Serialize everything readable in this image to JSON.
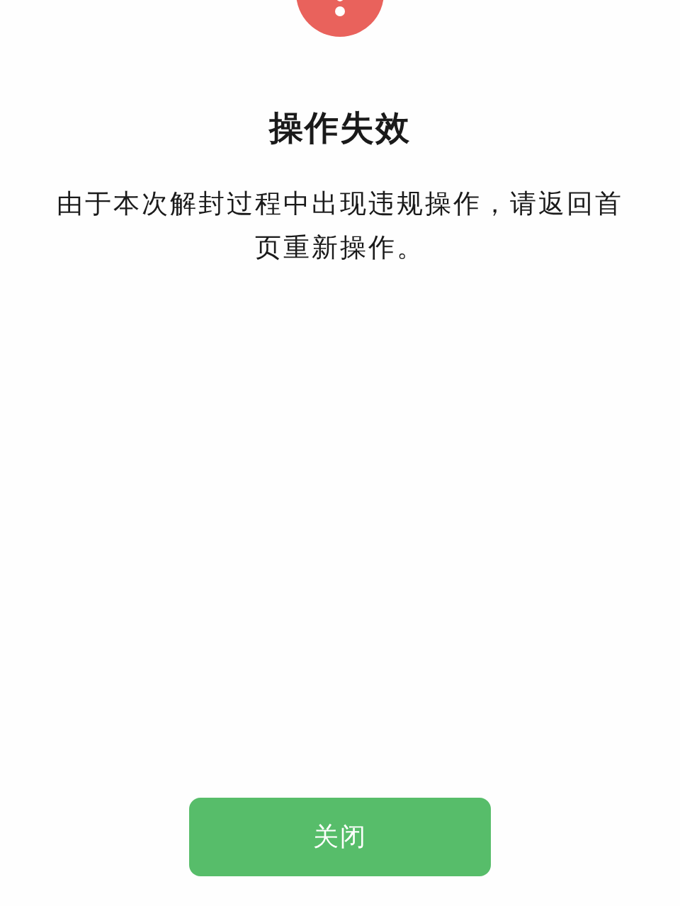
{
  "title": "操作失效",
  "message": "由于本次解封过程中出现违规操作，请返回首页重新操作。",
  "close_button": {
    "label": "关闭"
  }
}
